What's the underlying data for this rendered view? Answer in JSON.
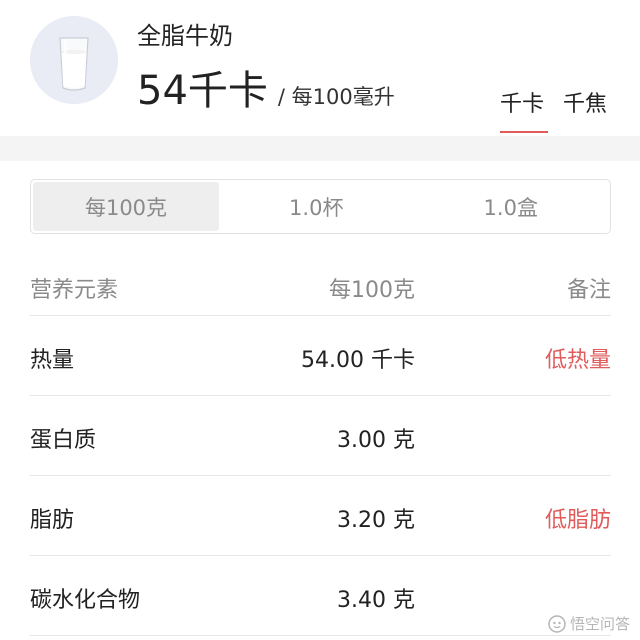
{
  "header": {
    "food_name": "全脂牛奶",
    "energy_value": "54",
    "energy_unit": "千卡",
    "energy_per": "/ 每100毫升",
    "units": [
      "千卡",
      "千焦"
    ],
    "active_unit": "千卡"
  },
  "portion_tabs": [
    {
      "label": "每100克",
      "active": true
    },
    {
      "label": "1.0杯",
      "active": false
    },
    {
      "label": "1.0盒",
      "active": false
    }
  ],
  "table": {
    "headers": [
      "营养元素",
      "每100克",
      "备注"
    ],
    "rows": [
      {
        "name": "热量",
        "value": "54.00 千卡",
        "note": "低热量"
      },
      {
        "name": "蛋白质",
        "value": "3.00 克",
        "note": ""
      },
      {
        "name": "脂肪",
        "value": "3.20 克",
        "note": "低脂肪"
      },
      {
        "name": "碳水化合物",
        "value": "3.40 克",
        "note": ""
      }
    ]
  },
  "colors": {
    "accent": "#e05c5c",
    "muted_text": "#8a8a8a",
    "divider": "#e6e6e6"
  },
  "watermark": {
    "text": "悟空问答"
  }
}
